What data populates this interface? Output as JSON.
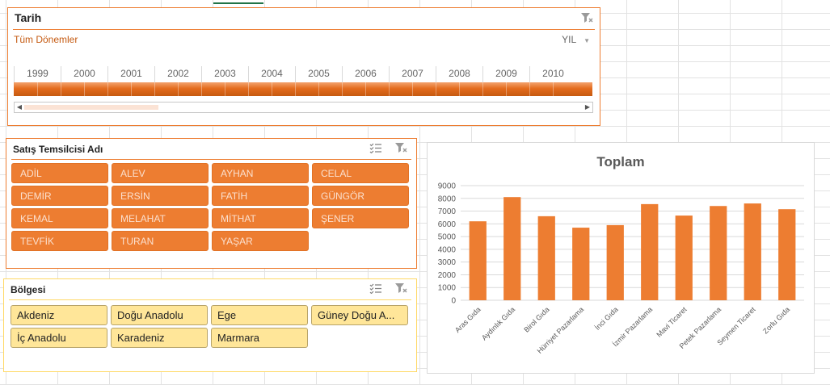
{
  "timeline": {
    "title": "Tarih",
    "period_label": "Tüm Dönemler",
    "level_label": "YIL",
    "years": [
      "1999",
      "2000",
      "2001",
      "2002",
      "2003",
      "2004",
      "2005",
      "2006",
      "2007",
      "2008",
      "2009",
      "2010"
    ]
  },
  "rep_slicer": {
    "title": "Satış Temsilcisi Adı",
    "items": [
      "ADİL",
      "ALEV",
      "AYHAN",
      "CELAL",
      "DEMİR",
      "ERSİN",
      "FATİH",
      "GÜNGÖR",
      "KEMAL",
      "MELAHAT",
      "MİTHAT",
      "ŞENER",
      "TEVFİK",
      "TURAN",
      "YAŞAR"
    ]
  },
  "region_slicer": {
    "title": "Bölgesi",
    "items": [
      "Akdeniz",
      "Doğu Anadolu",
      "Ege",
      "Güney Doğu A...",
      "İç Anadolu",
      "Karadeniz",
      "Marmara"
    ]
  },
  "icons": {
    "multiselect": "multi-select-icon",
    "clear_filter": "clear-filter-icon",
    "dropdown": "chevron-down-icon"
  },
  "colors": {
    "accent_orange": "#ED7D31",
    "region_yellow": "#FFE699",
    "region_border": "#FFD966"
  },
  "chart_data": {
    "type": "bar",
    "title": "Toplam",
    "categories": [
      "Aras Gıda",
      "Aydınlık Gıda",
      "Birol Gıda",
      "Hürriyet Pazarlama",
      "İnci Gıda",
      "İzmir Pazarlama",
      "Mavi Ticaret",
      "Petek Pazarlama",
      "Seymen Ticaret",
      "Zorlu Gıda"
    ],
    "values": [
      6200,
      8100,
      6600,
      5700,
      5900,
      7550,
      6650,
      7400,
      7600,
      7150
    ],
    "ylim": [
      0,
      9000
    ],
    "yticks": [
      "0",
      "1000",
      "2000",
      "3000",
      "4000",
      "5000",
      "6000",
      "7000",
      "8000",
      "9000"
    ],
    "grid": true,
    "bar_color": "#ED7D31"
  }
}
